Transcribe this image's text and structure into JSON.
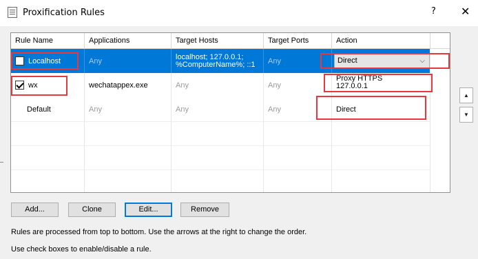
{
  "window": {
    "title": "Proxification Rules",
    "help_label": "?",
    "close_label": "✕"
  },
  "table": {
    "headers": [
      "Rule Name",
      "Applications",
      "Target Hosts",
      "Target Ports",
      "Action"
    ],
    "rows": [
      {
        "name": "Localhost",
        "checked": false,
        "applications": "Any",
        "hosts_line1": "localhost; 127.0.0.1;",
        "hosts_line2": "%ComputerName%; ::1",
        "ports": "Any",
        "action": "Direct"
      },
      {
        "name": "wx",
        "checked": true,
        "applications": "wechatappex.exe",
        "hosts": "Any",
        "ports": "Any",
        "action_line1": "Proxy HTTPS",
        "action_line2": "127.0.0.1"
      },
      {
        "name": "Default",
        "applications": "Any",
        "hosts": "Any",
        "ports": "Any",
        "action": "Direct"
      }
    ]
  },
  "side_buttons": {
    "up": "▲",
    "down": "▼"
  },
  "buttons": {
    "add": "Add...",
    "clone": "Clone",
    "edit": "Edit...",
    "remove": "Remove"
  },
  "notes": {
    "line1": "Rules are processed from top to bottom. Use the arrows at the right to change the order.",
    "line2": "Use check boxes to enable/disable a rule."
  },
  "colors": {
    "selection": "#0078d7",
    "highlight_box": "#e8383d"
  }
}
